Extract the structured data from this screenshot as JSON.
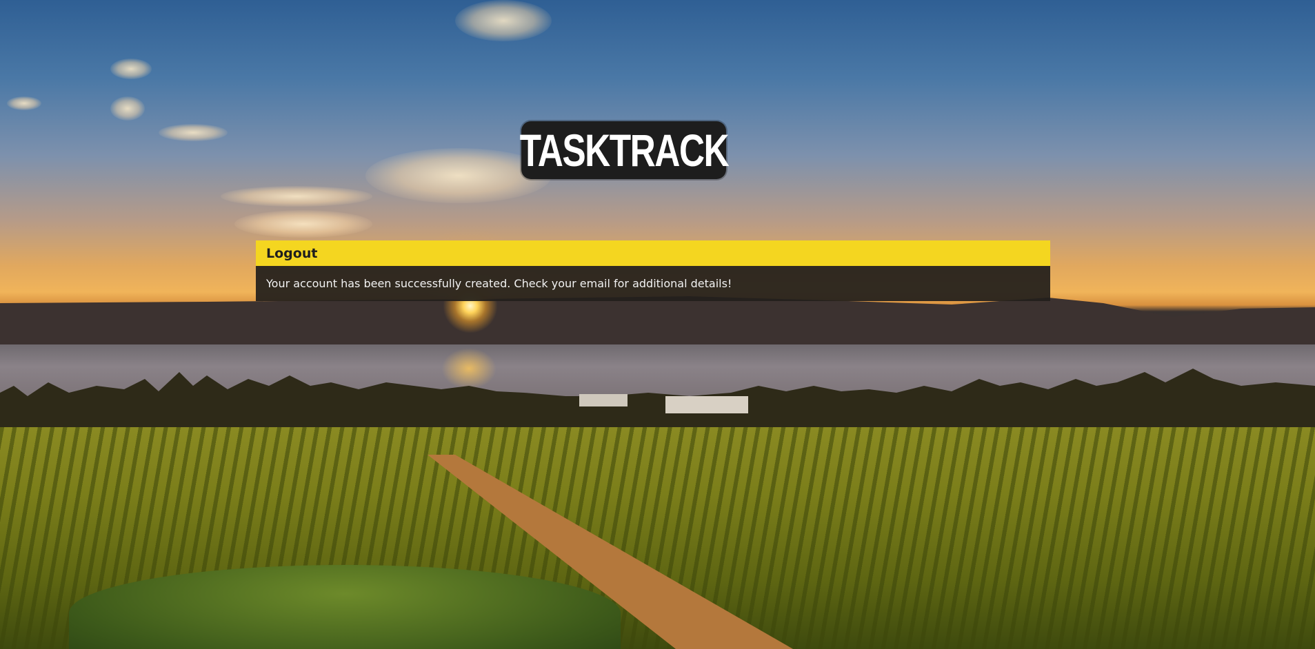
{
  "logo": {
    "text": "TASKTRACK"
  },
  "panel": {
    "title": "Logout",
    "message": "Your account has been successfully created. Check your email for additional details!"
  },
  "colors": {
    "accent": "#f4d620",
    "panel_body": "#221f1c",
    "logo_background": "#1d1d1d"
  }
}
